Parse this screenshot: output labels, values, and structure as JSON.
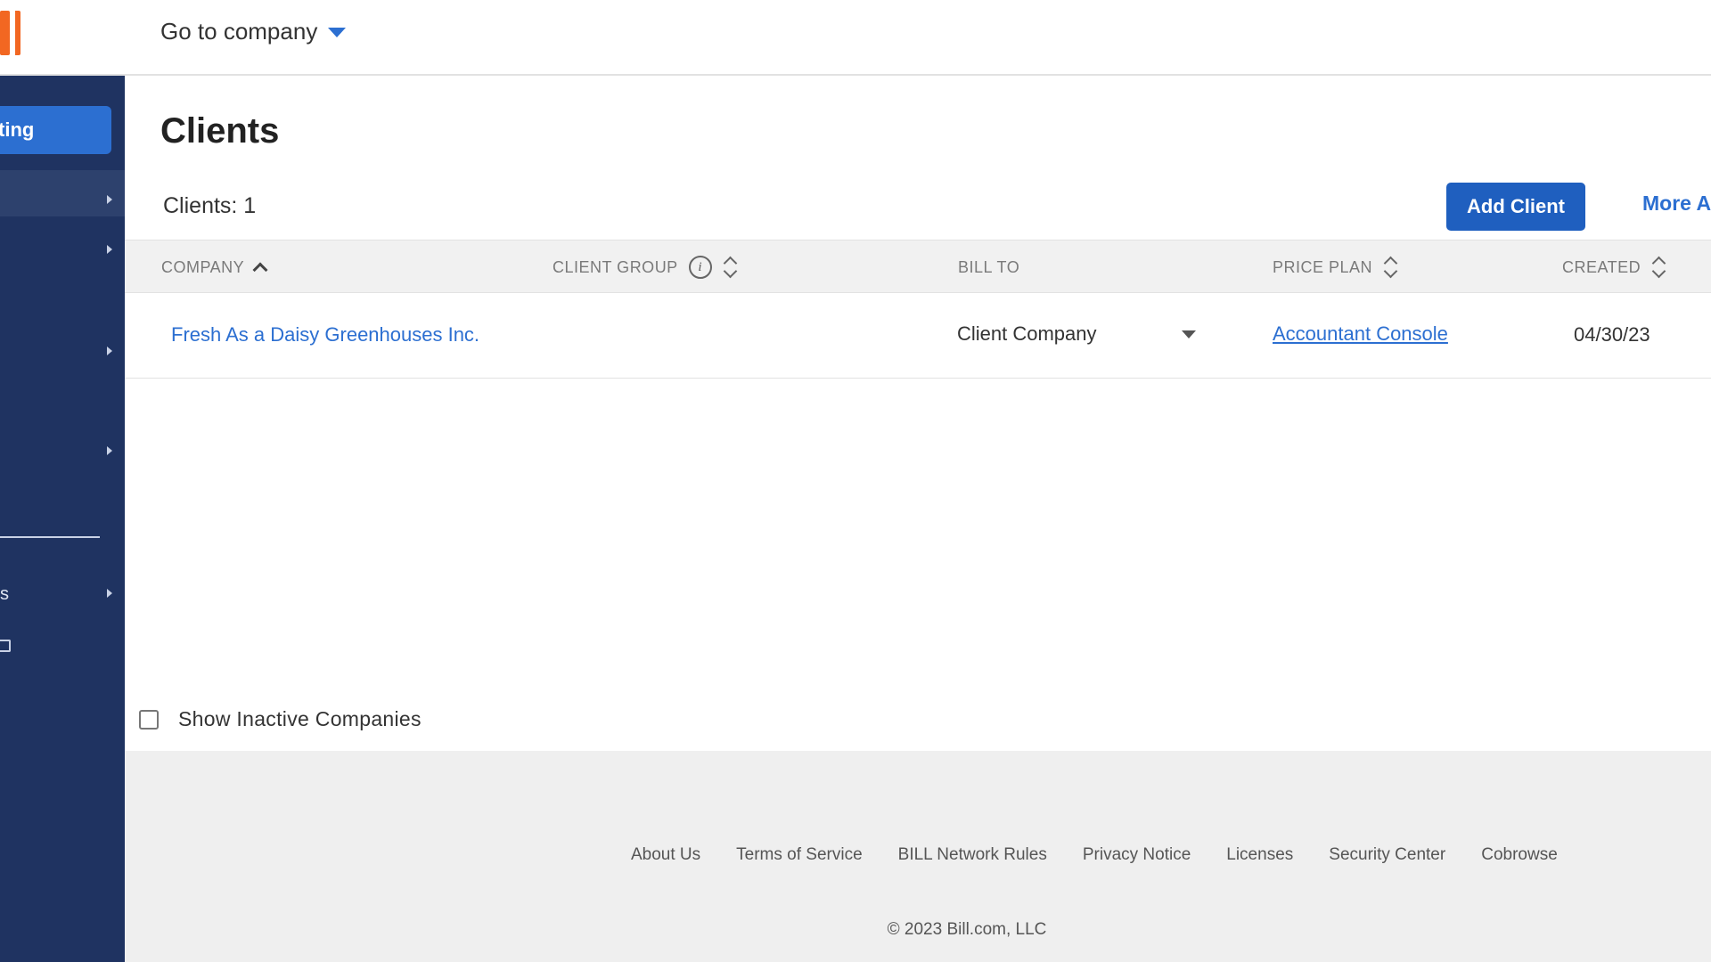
{
  "header": {
    "goto_label": "Go to company"
  },
  "sidebar": {
    "active_fragment": "ting",
    "lower_fragment": "s"
  },
  "main": {
    "title": "Clients",
    "count_label": "Clients: 1",
    "add_client_label": "Add Client",
    "more_actions_label": "More A"
  },
  "table": {
    "columns": [
      "COMPANY",
      "CLIENT GROUP",
      "BILL TO",
      "PRICE PLAN",
      "CREATED"
    ],
    "rows": [
      {
        "company": "Fresh As a Daisy Greenhouses Inc.",
        "client_group": "",
        "bill_to": "Client Company",
        "price_plan": "Accountant Console",
        "created": "04/30/23"
      }
    ]
  },
  "options": {
    "show_inactive_label": "Show Inactive Companies"
  },
  "footer": {
    "links": [
      "About Us",
      "Terms of Service",
      "BILL Network Rules",
      "Privacy Notice",
      "Licenses",
      "Security Center",
      "Cobrowse"
    ],
    "copyright": "© 2023 Bill.com, LLC"
  },
  "colors": {
    "brand_orange": "#f26722",
    "sidebar_navy": "#1f3361",
    "accent_blue": "#2c6fd1",
    "button_blue": "#1f5fbf"
  }
}
